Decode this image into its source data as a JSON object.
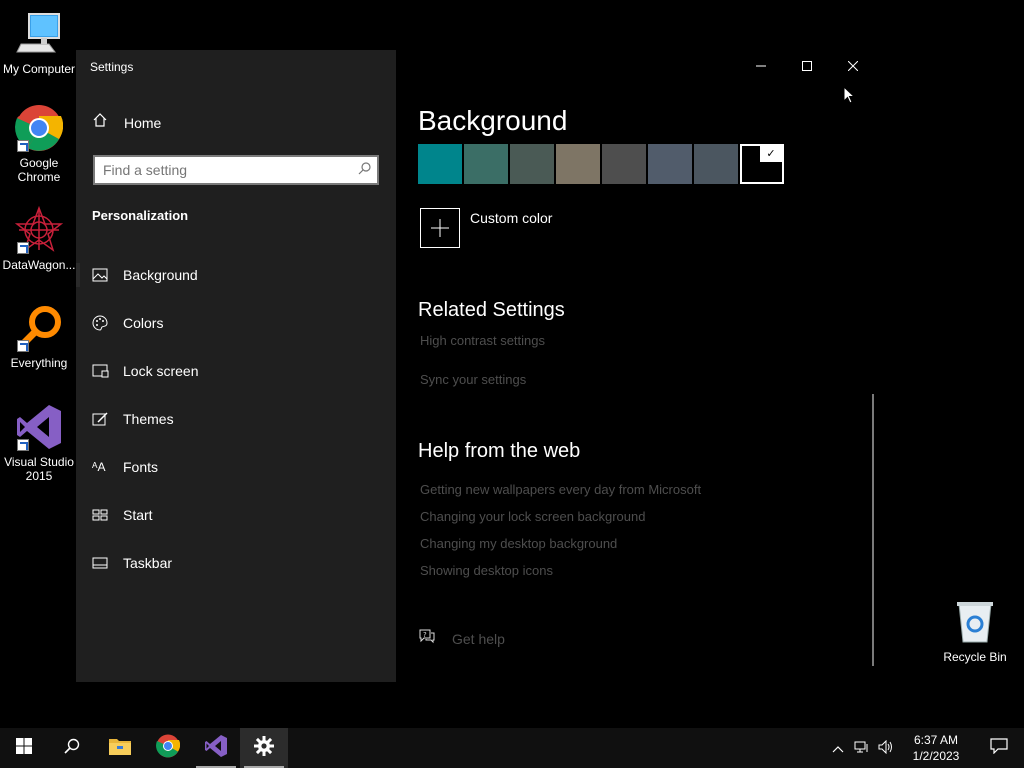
{
  "desktop": {
    "icons": [
      {
        "label": "My Computer",
        "icon": "monitor-icon"
      },
      {
        "label": "Google Chrome",
        "icon": "chrome-icon"
      },
      {
        "label": "DataWagon...",
        "icon": "datawagon-icon"
      },
      {
        "label": "Everything",
        "icon": "everything-search-icon"
      },
      {
        "label": "Visual Studio 2015",
        "icon": "visual-studio-icon"
      }
    ],
    "recycle_bin": {
      "label": "Recycle Bin",
      "icon": "recycle-bin-icon"
    }
  },
  "window": {
    "title": "Settings",
    "controls": {
      "minimize": "–",
      "maximize": "☐",
      "close": "✕"
    }
  },
  "sidebar": {
    "home_label": "Home",
    "search_placeholder": "Find a setting",
    "section_title": "Personalization",
    "items": [
      {
        "label": "Background",
        "icon": "picture-icon"
      },
      {
        "label": "Colors",
        "icon": "palette-icon"
      },
      {
        "label": "Lock screen",
        "icon": "lock-screen-icon"
      },
      {
        "label": "Themes",
        "icon": "themes-brush-icon"
      },
      {
        "label": "Fonts",
        "icon": "fonts-icon"
      },
      {
        "label": "Start",
        "icon": "start-grid-icon"
      },
      {
        "label": "Taskbar",
        "icon": "taskbar-icon"
      }
    ],
    "selected_index": 0
  },
  "content": {
    "heading": "Background",
    "swatches": [
      "#00858c",
      "#3b6e66",
      "#4a5a55",
      "#7e7565",
      "#4e4e4e",
      "#515c6b",
      "#4b5660",
      "#000000"
    ],
    "selected_swatch": 7,
    "custom_color_label": "Custom color",
    "related": {
      "heading": "Related Settings",
      "links": [
        "High contrast settings",
        "Sync your settings"
      ]
    },
    "help": {
      "heading": "Help from the web",
      "links": [
        "Getting new wallpapers every day from Microsoft",
        "Changing your lock screen background",
        "Changing my desktop background",
        "Showing desktop icons"
      ],
      "get_help_label": "Get help"
    }
  },
  "taskbar": {
    "clock_time": "6:37 AM",
    "clock_date": "1/2/2023",
    "buttons": [
      "windows-start-icon",
      "search-icon",
      "file-explorer-icon",
      "chrome-icon",
      "visual-studio-icon",
      "settings-gear-icon"
    ]
  }
}
